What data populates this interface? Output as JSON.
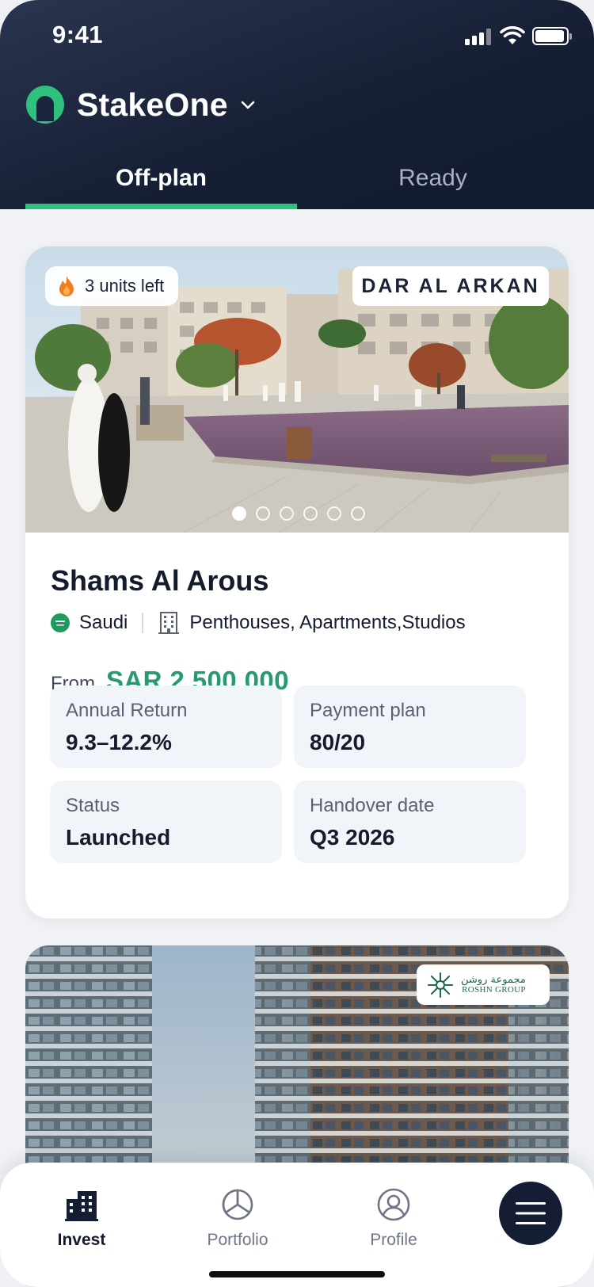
{
  "status_bar": {
    "time": "9:41"
  },
  "header": {
    "brand_name": "StakeOne",
    "tabs": [
      {
        "label": "Off-plan",
        "active": true
      },
      {
        "label": "Ready",
        "active": false
      }
    ]
  },
  "listing": {
    "badge_text": "3 units left",
    "developer": "DAR AL ARKAN",
    "carousel": {
      "total": 6,
      "active_index": 0
    },
    "title": "Shams Al Arous",
    "country": "Saudi",
    "property_types": "Penthouses, Apartments,Studios",
    "price_prefix": "From",
    "price": "SAR 2,500,000",
    "stats": [
      {
        "label": "Annual Return",
        "value": "9.3–12.2%"
      },
      {
        "label": "Payment plan",
        "value": "80/20"
      },
      {
        "label": "Status",
        "value": "Launched"
      },
      {
        "label": "Handover date",
        "value": "Q3 2026"
      }
    ]
  },
  "listing2": {
    "developer_ar": "مجموعة روشن",
    "developer_en": "ROSHN GROUP"
  },
  "bottom_nav": {
    "items": [
      {
        "label": "Invest",
        "icon": "buildings-icon",
        "active": true
      },
      {
        "label": "Portfolio",
        "icon": "pie-chart-icon",
        "active": false
      },
      {
        "label": "Profile",
        "icon": "user-circle-icon",
        "active": false
      }
    ],
    "menu_icon": "hamburger-icon"
  },
  "colors": {
    "header_bg": "#161f35",
    "accent_green": "#2fc07b",
    "price_green": "#279a73",
    "stat_bg": "#f1f4f8"
  }
}
